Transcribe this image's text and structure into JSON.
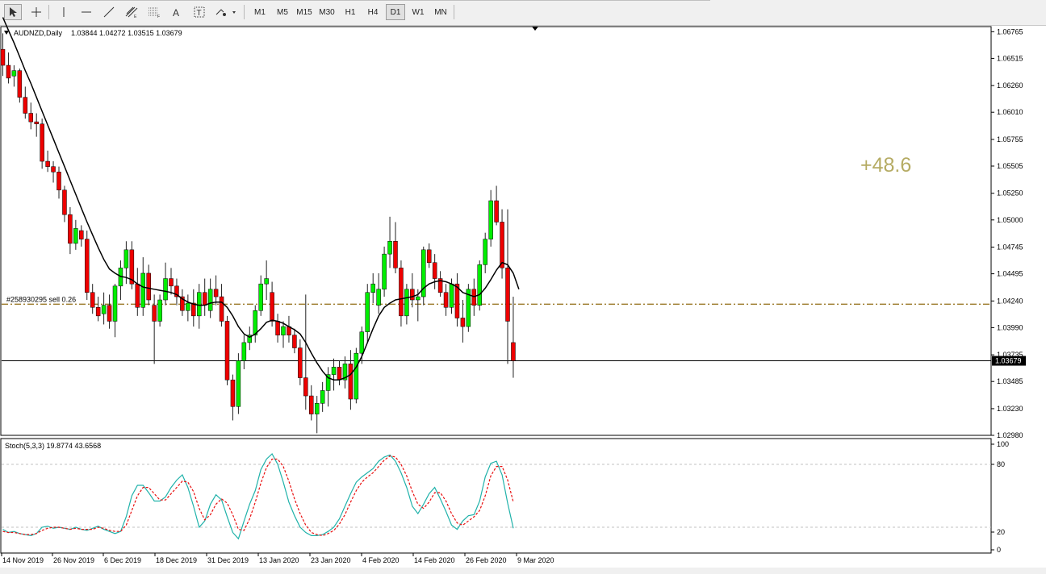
{
  "toolbar": {
    "timeframes": [
      "M1",
      "M5",
      "M15",
      "M30",
      "H1",
      "H4",
      "D1",
      "W1",
      "MN"
    ],
    "active_timeframe": "D1"
  },
  "chart_data": [
    {
      "type": "candlestick",
      "title": "AUDNZD,Daily",
      "ohlc_summary": "1.03844 1.04272 1.03515 1.03679",
      "ylim": [
        1.0298,
        1.0678
      ],
      "price_ticks": [
        "1.06765",
        "1.06515",
        "1.06260",
        "1.06010",
        "1.05755",
        "1.05505",
        "1.05250",
        "1.05000",
        "1.04745",
        "1.04495",
        "1.04240",
        "1.03990",
        "1.03735",
        "1.03485",
        "1.03230",
        "1.02980"
      ],
      "current_price": "1.03679",
      "order_line": {
        "label": "#258930295 sell 0.26",
        "price": 1.0421
      },
      "profit_text": "+48.6",
      "colors": {
        "bull": "#00ee00",
        "bear": "#ee0000",
        "wick": "#222222",
        "ma": "#000000",
        "order": "#9b7a2a",
        "profit": "#b5ab63"
      },
      "time_labels": [
        "14 Nov 2019",
        "26 Nov 2019",
        "6 Dec 2019",
        "18 Dec 2019",
        "31 Dec 2019",
        "13 Jan 2020",
        "23 Jan 2020",
        "4 Feb 2020",
        "14 Feb 2020",
        "26 Feb 2020",
        "9 Mar 2020"
      ],
      "candles": [
        [
          1.066,
          1.0675,
          1.0635,
          1.0645
        ],
        [
          1.0645,
          1.0657,
          1.0628,
          1.0633
        ],
        [
          1.0635,
          1.0645,
          1.0625,
          1.064
        ],
        [
          1.064,
          1.0642,
          1.061,
          1.0615
        ],
        [
          1.0615,
          1.0625,
          1.0595,
          1.06
        ],
        [
          1.06,
          1.061,
          1.0585,
          1.0592
        ],
        [
          1.0592,
          1.06,
          1.0578,
          1.059
        ],
        [
          1.059,
          1.0595,
          1.0548,
          1.0555
        ],
        [
          1.0555,
          1.0565,
          1.0545,
          1.055
        ],
        [
          1.055,
          1.0555,
          1.0535,
          1.0545
        ],
        [
          1.0545,
          1.055,
          1.052,
          1.0528
        ],
        [
          1.0528,
          1.0532,
          1.0498,
          1.0505
        ],
        [
          1.0505,
          1.0512,
          1.0468,
          1.0478
        ],
        [
          1.0478,
          1.05,
          1.0472,
          1.0492
        ],
        [
          1.049,
          1.0495,
          1.0475,
          1.0482
        ],
        [
          1.0482,
          1.049,
          1.0425,
          1.0432
        ],
        [
          1.0432,
          1.044,
          1.0412,
          1.0418
        ],
        [
          1.0418,
          1.0428,
          1.0405,
          1.041
        ],
        [
          1.0412,
          1.0432,
          1.0402,
          1.042
        ],
        [
          1.042,
          1.043,
          1.0398,
          1.0405
        ],
        [
          1.0405,
          1.044,
          1.039,
          1.0438
        ],
        [
          1.0438,
          1.0462,
          1.0425,
          1.0455
        ],
        [
          1.0455,
          1.048,
          1.044,
          1.0472
        ],
        [
          1.0472,
          1.048,
          1.0435,
          1.044
        ],
        [
          1.044,
          1.0455,
          1.041,
          1.0418
        ],
        [
          1.0418,
          1.0465,
          1.041,
          1.045
        ],
        [
          1.045,
          1.0458,
          1.042,
          1.0425
        ],
        [
          1.042,
          1.043,
          1.0365,
          1.0405
        ],
        [
          1.0405,
          1.043,
          1.04,
          1.0425
        ],
        [
          1.0425,
          1.046,
          1.042,
          1.0445
        ],
        [
          1.0445,
          1.0455,
          1.043,
          1.0438
        ],
        [
          1.0438,
          1.0445,
          1.042,
          1.0428
        ],
        [
          1.0428,
          1.0435,
          1.041,
          1.0415
        ],
        [
          1.0415,
          1.043,
          1.0405,
          1.0422
        ],
        [
          1.0422,
          1.0435,
          1.04,
          1.041
        ],
        [
          1.041,
          1.044,
          1.0398,
          1.0432
        ],
        [
          1.0432,
          1.0445,
          1.041,
          1.042
        ],
        [
          1.0415,
          1.0445,
          1.0408,
          1.0435
        ],
        [
          1.0435,
          1.0448,
          1.042,
          1.0428
        ],
        [
          1.0428,
          1.044,
          1.04,
          1.0405
        ],
        [
          1.0405,
          1.041,
          1.0345,
          1.035
        ],
        [
          1.035,
          1.0355,
          1.0312,
          1.0325
        ],
        [
          1.0325,
          1.0375,
          1.0318,
          1.0368
        ],
        [
          1.0368,
          1.0392,
          1.036,
          1.0385
        ],
        [
          1.0385,
          1.04,
          1.0378,
          1.0392
        ],
        [
          1.0392,
          1.042,
          1.0385,
          1.0415
        ],
        [
          1.0415,
          1.0448,
          1.041,
          1.044
        ],
        [
          1.044,
          1.0462,
          1.0425,
          1.0445
        ],
        [
          1.0432,
          1.0442,
          1.04,
          1.0405
        ],
        [
          1.0405,
          1.0412,
          1.0385,
          1.0392
        ],
        [
          1.0392,
          1.0405,
          1.038,
          1.04
        ],
        [
          1.04,
          1.041,
          1.0385,
          1.0392
        ],
        [
          1.0392,
          1.0398,
          1.0375,
          1.038
        ],
        [
          1.038,
          1.0388,
          1.0345,
          1.0352
        ],
        [
          1.0352,
          1.043,
          1.0322,
          1.0335
        ],
        [
          1.0335,
          1.0345,
          1.0312,
          1.0318
        ],
        [
          1.0318,
          1.0335,
          1.03,
          1.0328
        ],
        [
          1.0328,
          1.0348,
          1.032,
          1.034
        ],
        [
          1.034,
          1.0362,
          1.0325,
          1.0355
        ],
        [
          1.0355,
          1.037,
          1.034,
          1.0362
        ],
        [
          1.0362,
          1.0368,
          1.0345,
          1.035
        ],
        [
          1.035,
          1.0372,
          1.0342,
          1.0365
        ],
        [
          1.0365,
          1.0378,
          1.0322,
          1.0332
        ],
        [
          1.0332,
          1.038,
          1.0328,
          1.0375
        ],
        [
          1.0375,
          1.04,
          1.0365,
          1.0395
        ],
        [
          1.0395,
          1.044,
          1.0385,
          1.0432
        ],
        [
          1.0432,
          1.045,
          1.0422,
          1.044
        ],
        [
          1.042,
          1.045,
          1.0412,
          1.0435
        ],
        [
          1.0435,
          1.0475,
          1.0428,
          1.0468
        ],
        [
          1.0468,
          1.0503,
          1.0455,
          1.048
        ],
        [
          1.048,
          1.0498,
          1.045,
          1.0455
        ],
        [
          1.0455,
          1.0462,
          1.04,
          1.041
        ],
        [
          1.041,
          1.044,
          1.0402,
          1.0435
        ],
        [
          1.0435,
          1.045,
          1.0418,
          1.0425
        ],
        [
          1.0425,
          1.0435,
          1.0405,
          1.0428
        ],
        [
          1.0428,
          1.0475,
          1.042,
          1.0472
        ],
        [
          1.0472,
          1.0478,
          1.0455,
          1.046
        ],
        [
          1.046,
          1.0468,
          1.0435,
          1.0445
        ],
        [
          1.0445,
          1.0452,
          1.0428,
          1.0432
        ],
        [
          1.0432,
          1.044,
          1.041,
          1.0418
        ],
        [
          1.0418,
          1.0445,
          1.0412,
          1.044
        ],
        [
          1.044,
          1.045,
          1.04,
          1.0408
        ],
        [
          1.0408,
          1.0425,
          1.0385,
          1.04
        ],
        [
          1.04,
          1.044,
          1.0395,
          1.0435
        ],
        [
          1.0435,
          1.0445,
          1.041,
          1.042
        ],
        [
          1.042,
          1.0462,
          1.0415,
          1.0458
        ],
        [
          1.0458,
          1.0488,
          1.045,
          1.0482
        ],
        [
          1.0482,
          1.0528,
          1.0475,
          1.0518
        ],
        [
          1.0518,
          1.0532,
          1.0495,
          1.0498
        ],
        [
          1.0498,
          1.051,
          1.0445,
          1.0455
        ],
        [
          1.0455,
          1.051,
          1.0365,
          1.0405
        ],
        [
          1.0385,
          1.0428,
          1.0352,
          1.0368
        ]
      ],
      "ma": [
        1.069,
        1.0678,
        1.0666,
        1.0653,
        1.064,
        1.0628,
        1.0615,
        1.0602,
        1.0589,
        1.0576,
        1.0563,
        1.055,
        1.0537,
        1.0524,
        1.0511,
        1.0498,
        1.0486,
        1.0474,
        1.0463,
        1.0454,
        1.045,
        1.0447,
        1.0446,
        1.0444,
        1.044,
        1.0437,
        1.0436,
        1.0435,
        1.0434,
        1.0433,
        1.0432,
        1.043,
        1.0426,
        1.0423,
        1.0421,
        1.042,
        1.042,
        1.0422,
        1.0423,
        1.0423,
        1.0418,
        1.041,
        1.04,
        1.0393,
        1.039,
        1.0393,
        1.0398,
        1.0404,
        1.0406,
        1.0405,
        1.0403,
        1.04,
        1.0397,
        1.0393,
        1.0385,
        1.0375,
        1.0366,
        1.0358,
        1.0352,
        1.035,
        1.035,
        1.0352,
        1.0355,
        1.0362,
        1.0372,
        1.0385,
        1.0398,
        1.041,
        1.0418,
        1.0422,
        1.0425,
        1.0426,
        1.0427,
        1.0428,
        1.043,
        1.0436,
        1.044,
        1.0442,
        1.0443,
        1.0442,
        1.044,
        1.0437,
        1.0432,
        1.043,
        1.0428,
        1.043,
        1.0436,
        1.0444,
        1.0453,
        1.046,
        1.0458,
        1.045,
        1.0435
      ]
    },
    {
      "type": "line",
      "title": "Stoch(5,3,3) 19.8774 43.6568",
      "ylim": [
        0,
        100
      ],
      "y_ticks": [
        "100",
        "80",
        "20",
        "0"
      ],
      "levels": [
        80,
        20
      ],
      "series": [
        {
          "color": "#20b2aa",
          "values": [
            18,
            15,
            16,
            14,
            13,
            12,
            14,
            20,
            21,
            19,
            20,
            19,
            18,
            20,
            18,
            17,
            19,
            21,
            18,
            16,
            14,
            16,
            30,
            50,
            60,
            60,
            53,
            45,
            45,
            49,
            58,
            65,
            70,
            58,
            40,
            20,
            26,
            42,
            51,
            46,
            30,
            15,
            9,
            26,
            42,
            55,
            75,
            85,
            90,
            80,
            63,
            44,
            31,
            20,
            15,
            12,
            12,
            13,
            16,
            20,
            28,
            40,
            52,
            63,
            68,
            72,
            76,
            83,
            87,
            89,
            83,
            72,
            58,
            40,
            33,
            42,
            52,
            58,
            47,
            35,
            22,
            18,
            26,
            31,
            32,
            45,
            68,
            81,
            83,
            70,
            43,
            19
          ]
        },
        {
          "color": "#e81010",
          "dash": true,
          "values": [
            16,
            15,
            15,
            14,
            13,
            13,
            14,
            17,
            19,
            20,
            20,
            19,
            18,
            19,
            18,
            18,
            18,
            20,
            19,
            17,
            16,
            16,
            22,
            36,
            50,
            58,
            58,
            52,
            46,
            46,
            52,
            58,
            64,
            63,
            54,
            38,
            27,
            32,
            42,
            47,
            43,
            32,
            18,
            17,
            28,
            44,
            62,
            77,
            85,
            85,
            78,
            64,
            47,
            33,
            22,
            15,
            13,
            12,
            14,
            17,
            23,
            32,
            44,
            55,
            63,
            68,
            72,
            78,
            84,
            88,
            87,
            80,
            69,
            54,
            42,
            38,
            44,
            53,
            53,
            45,
            33,
            24,
            22,
            26,
            30,
            36,
            50,
            69,
            78,
            78,
            65,
            44
          ]
        }
      ]
    }
  ]
}
